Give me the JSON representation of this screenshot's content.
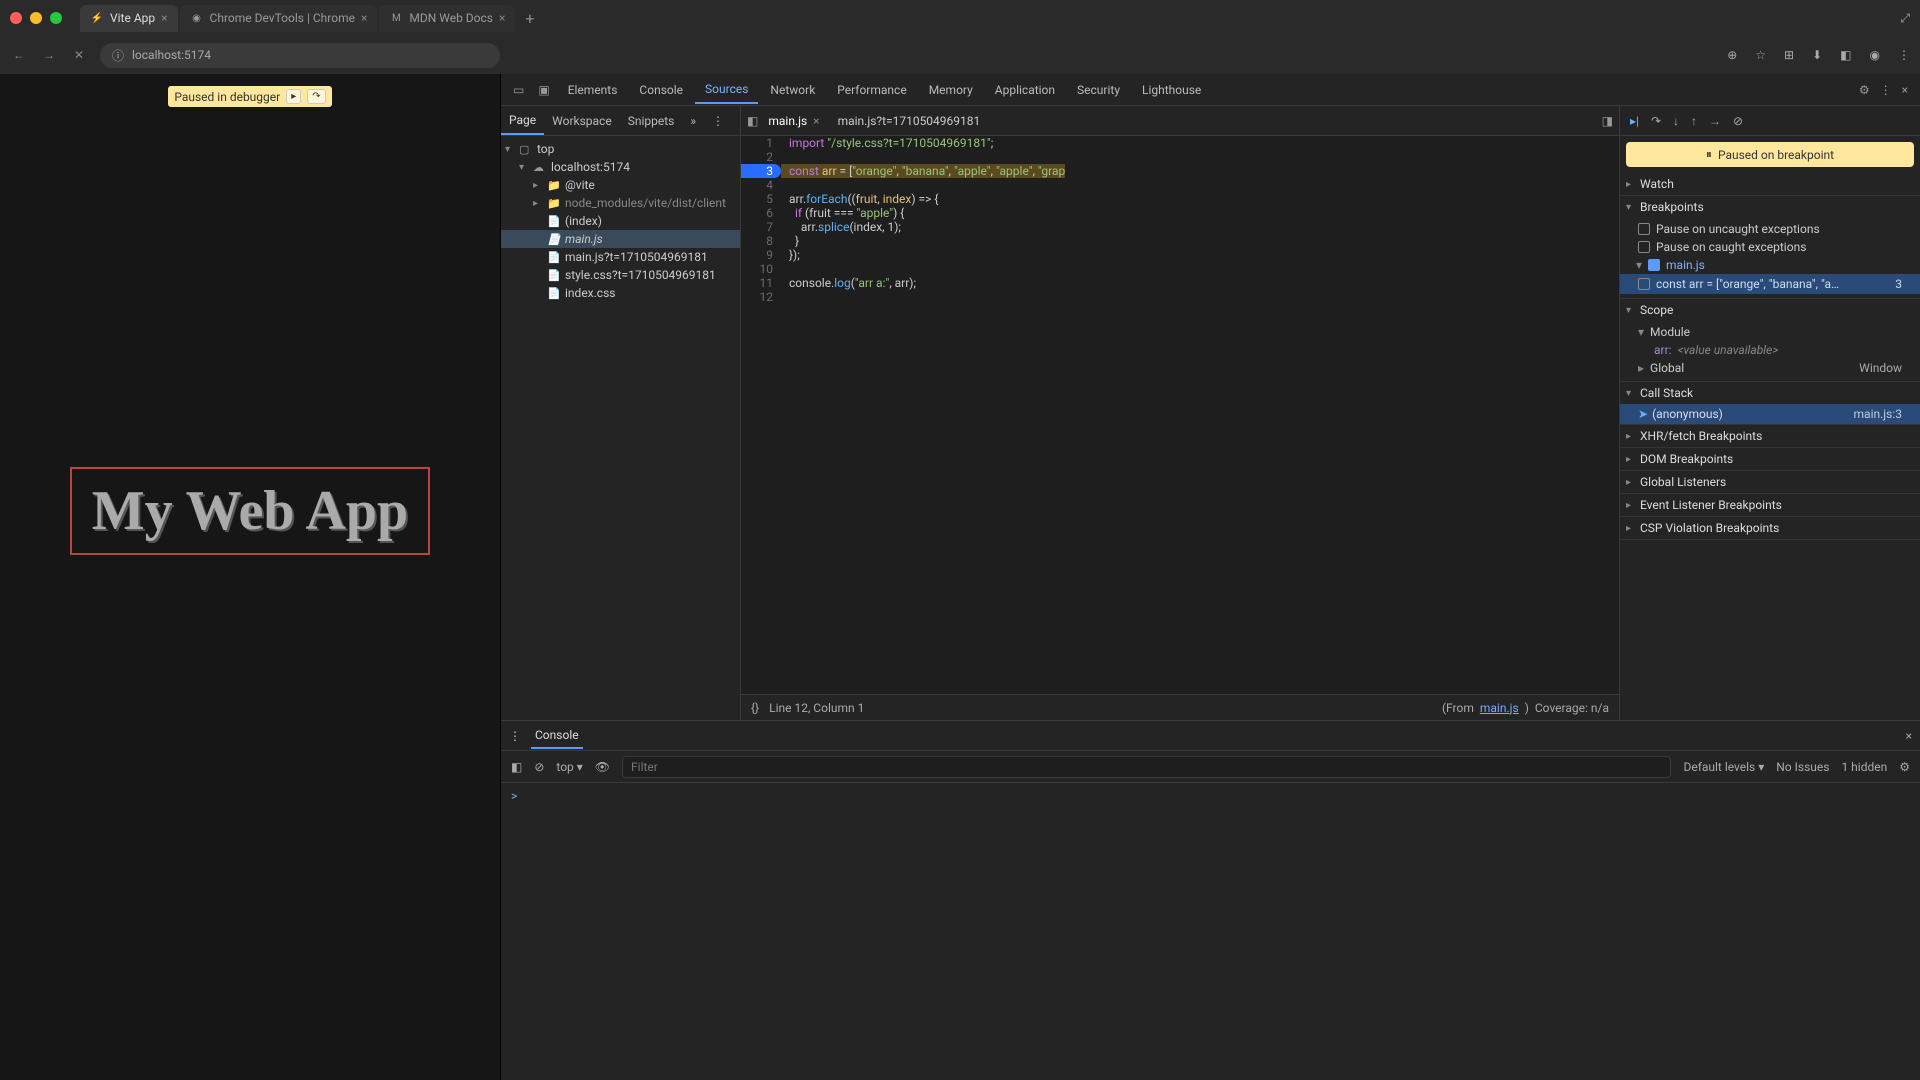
{
  "browser": {
    "tabs": [
      {
        "title": "Vite App",
        "favicon": "⚡"
      },
      {
        "title": "Chrome DevTools | Chrome",
        "favicon": "◉"
      },
      {
        "title": "MDN Web Docs",
        "favicon": "M"
      }
    ],
    "url": "localhost:5174"
  },
  "page": {
    "pause_text": "Paused in debugger",
    "heading": "My Web App"
  },
  "devtools": {
    "tabs": [
      "Elements",
      "Console",
      "Sources",
      "Network",
      "Performance",
      "Memory",
      "Application",
      "Security",
      "Lighthouse"
    ],
    "active_tab": "Sources"
  },
  "sources": {
    "sub_tabs": [
      "Page",
      "Workspace",
      "Snippets"
    ],
    "tree": {
      "top": "top",
      "host": "localhost:5174",
      "vite": "@vite",
      "node_modules": "node_modules/vite/dist/client",
      "files": [
        "(index)",
        "main.js",
        "main.js?t=1710504969181",
        "style.css?t=1710504969181",
        "index.css"
      ]
    },
    "open_files": [
      "main.js",
      "main.js?t=1710504969181"
    ],
    "code_lines": [
      {
        "n": 1,
        "t": "import \"/style.css?t=1710504969181\";"
      },
      {
        "n": 2,
        "t": ""
      },
      {
        "n": 3,
        "t": "const arr = [\"orange\", \"banana\", \"apple\", \"apple\", \"grap",
        "bp": true,
        "hl": true
      },
      {
        "n": 4,
        "t": ""
      },
      {
        "n": 5,
        "t": "arr.forEach((fruit, index) => {"
      },
      {
        "n": 6,
        "t": "  if (fruit === \"apple\") {"
      },
      {
        "n": 7,
        "t": "    arr.splice(index, 1);"
      },
      {
        "n": 8,
        "t": "  }"
      },
      {
        "n": 9,
        "t": "});"
      },
      {
        "n": 10,
        "t": ""
      },
      {
        "n": 11,
        "t": "console.log(\"arr a:\", arr);"
      },
      {
        "n": 12,
        "t": ""
      }
    ],
    "status": {
      "pos": "Line 12, Column 1",
      "from": "main.js",
      "from_label": "(From ",
      "coverage": "Coverage: n/a"
    }
  },
  "debugger": {
    "banner": "Paused on breakpoint",
    "sections": {
      "watch": "Watch",
      "breakpoints": "Breakpoints",
      "scope": "Scope",
      "callstack": "Call Stack",
      "xhr": "XHR/fetch Breakpoints",
      "dom": "DOM Breakpoints",
      "global_listeners": "Global Listeners",
      "event": "Event Listener Breakpoints",
      "csp": "CSP Violation Breakpoints"
    },
    "bp_checks": [
      "Pause on uncaught exceptions",
      "Pause on caught exceptions"
    ],
    "bp_file": "main.js",
    "bp_line_text": "const arr = [\"orange\", \"banana\", \"a…",
    "bp_line_num": "3",
    "scope": {
      "module": "Module",
      "arr_name": "arr:",
      "arr_val": "<value unavailable>",
      "global": "Global",
      "global_val": "Window"
    },
    "callstack": {
      "fn": "(anonymous)",
      "loc": "main.js:3"
    }
  },
  "drawer": {
    "tab": "Console",
    "context": "top",
    "filter_placeholder": "Filter",
    "levels": "Default levels",
    "no_issues": "No Issues",
    "hidden": "1 hidden",
    "prompt": ">"
  }
}
